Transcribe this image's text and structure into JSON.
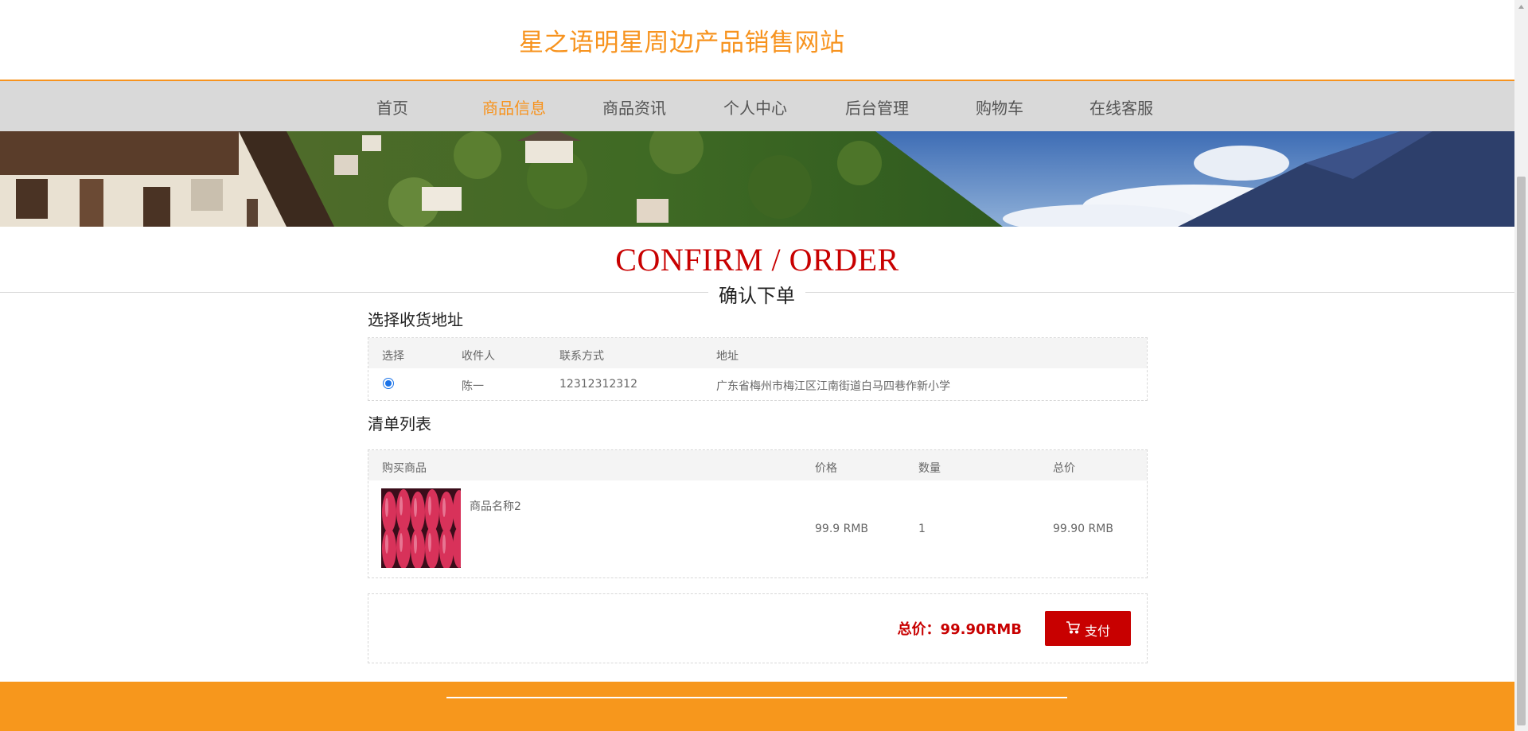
{
  "site": {
    "title": "星之语明星周边产品销售网站"
  },
  "nav": [
    {
      "label": "首页",
      "active": false
    },
    {
      "label": "商品信息",
      "active": true
    },
    {
      "label": "商品资讯",
      "active": false
    },
    {
      "label": "个人中心",
      "active": false
    },
    {
      "label": "后台管理",
      "active": false
    },
    {
      "label": "购物车",
      "active": false
    },
    {
      "label": "在线客服",
      "active": false
    }
  ],
  "heading": {
    "en": "CONFIRM / ORDER",
    "cn": "确认下单"
  },
  "address_section": {
    "title": "选择收货地址",
    "columns": [
      "选择",
      "收件人",
      "联系方式",
      "地址"
    ],
    "rows": [
      {
        "selected": true,
        "recipient": "陈一",
        "phone": "12312312312",
        "address": "广东省梅州市梅江区江南街道白马四巷作新小学"
      }
    ]
  },
  "order_section": {
    "title": "清单列表",
    "columns": [
      "购买商品",
      "价格",
      "数量",
      "总价"
    ],
    "items": [
      {
        "name": "商品名称2",
        "price": "99.9 RMB",
        "quantity": "1",
        "total": "99.90 RMB"
      }
    ]
  },
  "summary": {
    "total_label": "总价：99.90RMB",
    "pay_label": "支付"
  },
  "colors": {
    "brand": "#f7931e",
    "accent_red": "#c80000",
    "nav_bg": "#d9d9d9"
  }
}
